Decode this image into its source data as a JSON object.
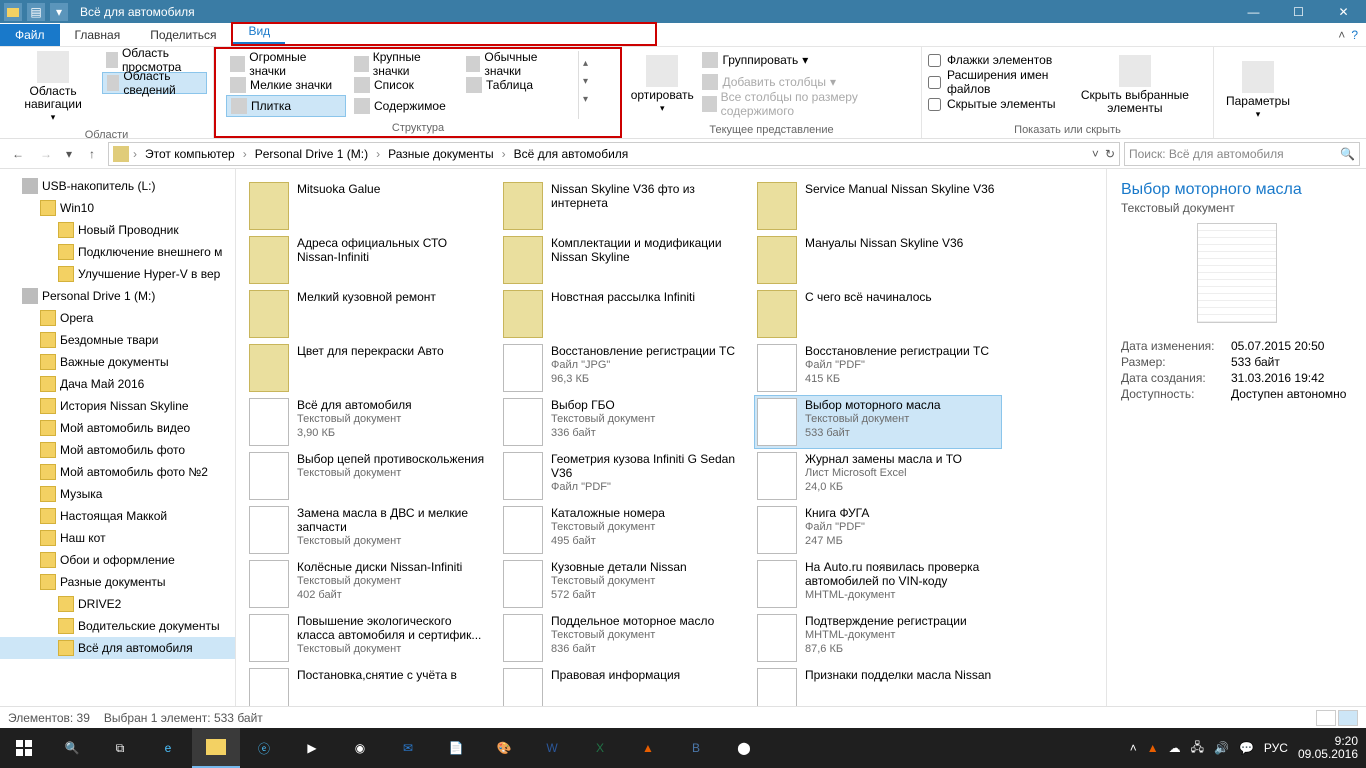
{
  "window": {
    "title": "Всё для автомобиля"
  },
  "tabs": {
    "file": "Файл",
    "home": "Главная",
    "share": "Поделиться",
    "view": "Вид"
  },
  "ribbon": {
    "nav": {
      "pane": "Область навигации",
      "preview": "Область просмотра",
      "details": "Область сведений",
      "group": "Области"
    },
    "layout": {
      "huge": "Огромные значки",
      "large": "Крупные значки",
      "medium": "Обычные значки",
      "small": "Мелкие значки",
      "list": "Список",
      "table": "Таблица",
      "tiles": "Плитка",
      "content": "Содержимое",
      "group": "Структура"
    },
    "view": {
      "sort_trunc": "ортировать",
      "group_by": "Группировать",
      "add_cols": "Добавить столбцы",
      "size_cols": "Все столбцы по размеру содержимого",
      "group": "Текущее представление"
    },
    "show": {
      "checkboxes": "Флажки элементов",
      "extensions": "Расширения имен файлов",
      "hidden": "Скрытые элементы",
      "hide_sel": "Скрыть выбранные элементы",
      "group": "Показать или скрыть"
    },
    "options": {
      "label": "Параметры"
    }
  },
  "breadcrumb": [
    "Этот компьютер",
    "Personal Drive 1 (M:)",
    "Разные документы",
    "Всё для автомобиля"
  ],
  "search_placeholder": "Поиск: Всё для автомобиля",
  "tree": [
    {
      "label": "USB-накопитель (L:)",
      "indent": 1,
      "icon": "drive"
    },
    {
      "label": "Win10",
      "indent": 2,
      "icon": "folder"
    },
    {
      "label": "Новый Проводник",
      "indent": 3,
      "icon": "folder"
    },
    {
      "label": "Подключение внешнего м",
      "indent": 3,
      "icon": "folder"
    },
    {
      "label": "Улучшение Hyper-V в вер",
      "indent": 3,
      "icon": "folder"
    },
    {
      "label": "Personal Drive 1 (M:)",
      "indent": 1,
      "icon": "drive"
    },
    {
      "label": "Opera",
      "indent": 2,
      "icon": "folder"
    },
    {
      "label": "Бездомные твари",
      "indent": 2,
      "icon": "folder"
    },
    {
      "label": "Важные документы",
      "indent": 2,
      "icon": "folder"
    },
    {
      "label": "Дача Май 2016",
      "indent": 2,
      "icon": "folder"
    },
    {
      "label": "История Nissan Skyline",
      "indent": 2,
      "icon": "folder"
    },
    {
      "label": "Мой автомобиль видео",
      "indent": 2,
      "icon": "folder"
    },
    {
      "label": "Мой автомобиль фото",
      "indent": 2,
      "icon": "folder"
    },
    {
      "label": "Мой автомобиль фото №2",
      "indent": 2,
      "icon": "folder"
    },
    {
      "label": "Музыка",
      "indent": 2,
      "icon": "folder"
    },
    {
      "label": "Настоящая Маккой",
      "indent": 2,
      "icon": "folder"
    },
    {
      "label": "Наш кот",
      "indent": 2,
      "icon": "folder"
    },
    {
      "label": "Обои и оформление",
      "indent": 2,
      "icon": "folder"
    },
    {
      "label": "Разные документы",
      "indent": 2,
      "icon": "folder"
    },
    {
      "label": "DRIVE2",
      "indent": 3,
      "icon": "folder"
    },
    {
      "label": "Водительские документы",
      "indent": 3,
      "icon": "folder"
    },
    {
      "label": "Всё для автомобиля",
      "indent": 3,
      "icon": "folder",
      "sel": true
    }
  ],
  "files": [
    {
      "name": "Mitsuoka Galue",
      "type": "folder"
    },
    {
      "name": "Nissan Skyline V36 фто из интернета",
      "type": "folder"
    },
    {
      "name": "Service Manual Nissan Skyline V36",
      "type": "folder"
    },
    {
      "name": "Адреса официальных СТО Nissan-Infiniti",
      "type": "folder"
    },
    {
      "name": "Комплектации и модификации Nissan Skyline",
      "type": "folder"
    },
    {
      "name": "Мануалы Nissan Skyline V36",
      "type": "folder"
    },
    {
      "name": "Мелкий кузовной ремонт",
      "type": "folder"
    },
    {
      "name": "Новстная рассылка Infiniti",
      "type": "folder"
    },
    {
      "name": "С чего всё начиналось",
      "type": "folder"
    },
    {
      "name": "Цвет для перекраски Авто",
      "type": "folder"
    },
    {
      "name": "Восстановление регистрации ТС",
      "sub1": "Файл \"JPG\"",
      "sub2": "96,3 КБ",
      "type": "doc"
    },
    {
      "name": "Восстановление регистрации ТС",
      "sub1": "Файл \"PDF\"",
      "sub2": "415 КБ",
      "type": "pdf"
    },
    {
      "name": "Всё для автомобиля",
      "sub1": "Текстовый документ",
      "sub2": "3,90 КБ",
      "type": "doc"
    },
    {
      "name": "Выбор ГБО",
      "sub1": "Текстовый документ",
      "sub2": "336 байт",
      "type": "doc"
    },
    {
      "name": "Выбор моторного масла",
      "sub1": "Текстовый документ",
      "sub2": "533 байт",
      "type": "doc",
      "sel": true
    },
    {
      "name": "Выбор цепей противоскольжения",
      "sub1": "Текстовый документ",
      "type": "doc"
    },
    {
      "name": "Геометрия кузова Infiniti G Sedan V36",
      "sub1": "Файл \"PDF\"",
      "type": "pdf"
    },
    {
      "name": "Журнал замены масла и ТО",
      "sub1": "Лист Microsoft Excel",
      "sub2": "24,0 КБ",
      "type": "xls"
    },
    {
      "name": "Замена масла в ДВС и мелкие запчасти",
      "sub1": "Текстовый документ",
      "type": "doc"
    },
    {
      "name": "Каталожные номера",
      "sub1": "Текстовый документ",
      "sub2": "495 байт",
      "type": "doc"
    },
    {
      "name": "Книга ФУГА",
      "sub1": "Файл \"PDF\"",
      "sub2": "247 МБ",
      "type": "pdf"
    },
    {
      "name": "Колёсные диски Nissan-Infiniti",
      "sub1": "Текстовый документ",
      "sub2": "402 байт",
      "type": "doc"
    },
    {
      "name": "Кузовные детали Nissan",
      "sub1": "Текстовый документ",
      "sub2": "572 байт",
      "type": "doc"
    },
    {
      "name": "На Auto.ru появилась проверка автомобилей по VIN-коду",
      "sub1": "MHTML-документ",
      "type": "doc"
    },
    {
      "name": "Повышение экологического класса автомобиля и сертифик...",
      "sub1": "Текстовый документ",
      "type": "doc"
    },
    {
      "name": "Поддельное моторное масло",
      "sub1": "Текстовый документ",
      "sub2": "836 байт",
      "type": "doc"
    },
    {
      "name": "Подтверждение регистрации",
      "sub1": "MHTML-документ",
      "sub2": "87,6 КБ",
      "type": "doc"
    },
    {
      "name": "Постановка,снятие с учёта в",
      "type": "doc"
    },
    {
      "name": "Правовая информация",
      "type": "doc"
    },
    {
      "name": "Признаки подделки масла Nissan",
      "type": "doc"
    }
  ],
  "details": {
    "title": "Выбор моторного масла",
    "type": "Текстовый документ",
    "rows": [
      {
        "l": "Дата изменения:",
        "v": "05.07.2015 20:50"
      },
      {
        "l": "Размер:",
        "v": "533 байт"
      },
      {
        "l": "Дата создания:",
        "v": "31.03.2016 19:42"
      },
      {
        "l": "Доступность:",
        "v": "Доступен автономно"
      }
    ]
  },
  "status": {
    "count": "Элементов: 39",
    "sel": "Выбран 1 элемент: 533 байт"
  },
  "tray": {
    "lang": "РУС",
    "time": "9:20",
    "date": "09.05.2016"
  }
}
